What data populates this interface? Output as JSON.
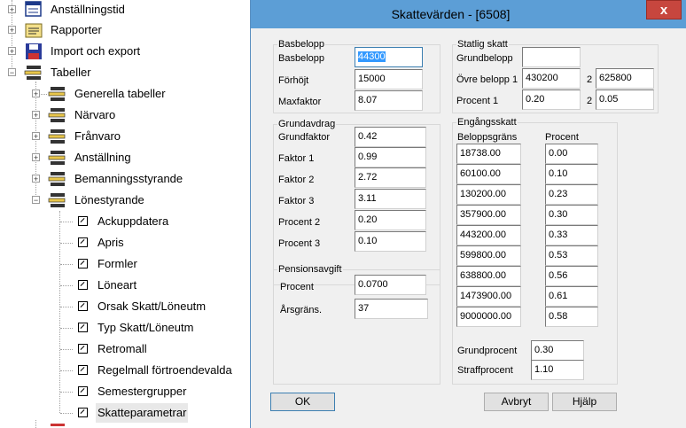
{
  "tree": {
    "items": [
      {
        "label": "Anställningstid",
        "icon": "calendar-icon"
      },
      {
        "label": "Rapporter",
        "icon": "report-icon"
      },
      {
        "label": "Import och export",
        "icon": "floppy-disk-icon"
      },
      {
        "label": "Tabeller",
        "icon": "table-stack-icon"
      },
      {
        "label": "Generella tabeller",
        "icon": "table-stack-icon"
      },
      {
        "label": "Närvaro",
        "icon": "table-stack-icon"
      },
      {
        "label": "Frånvaro",
        "icon": "table-stack-icon"
      },
      {
        "label": "Anställning",
        "icon": "table-stack-icon"
      },
      {
        "label": "Bemanningsstyrande",
        "icon": "table-stack-icon"
      },
      {
        "label": "Lönestyrande",
        "icon": "table-stack-icon"
      },
      {
        "label": "Ackuppdatera",
        "icon": "shortcut-icon"
      },
      {
        "label": "Apris",
        "icon": "shortcut-icon"
      },
      {
        "label": "Formler",
        "icon": "shortcut-icon"
      },
      {
        "label": "Löneart",
        "icon": "shortcut-icon"
      },
      {
        "label": "Orsak Skatt/Löneutm",
        "icon": "shortcut-icon"
      },
      {
        "label": "Typ Skatt/Löneutm",
        "icon": "shortcut-icon"
      },
      {
        "label": "Retromall",
        "icon": "shortcut-icon"
      },
      {
        "label": "Regelmall förtroendevalda",
        "icon": "shortcut-icon"
      },
      {
        "label": "Semestergrupper",
        "icon": "shortcut-icon"
      },
      {
        "label": "Skatteparametrar",
        "icon": "shortcut-icon"
      }
    ]
  },
  "dialog": {
    "title": "Skattevärden - [6508]",
    "close_label": "x",
    "basbelopp": {
      "group_label": "Basbelopp",
      "basbelopp_label": "Basbelopp",
      "basbelopp_value": "44300",
      "forhojt_label": "Förhöjt",
      "forhojt_value": "15000",
      "maxfaktor_label": "Maxfaktor",
      "maxfaktor_value": "8.07"
    },
    "grundavdrag": {
      "group_label": "Grundavdrag",
      "grundfaktor_label": "Grundfaktor",
      "grundfaktor_value": "0.42",
      "faktor1_label": "Faktor 1",
      "faktor1_value": "0.99",
      "faktor2_label": "Faktor 2",
      "faktor2_value": "2.72",
      "faktor3_label": "Faktor 3",
      "faktor3_value": "3.11",
      "procent2_label": "Procent 2",
      "procent2_value": "0.20",
      "procent3_label": "Procent 3",
      "procent3_value": "0.10"
    },
    "pensionsavgift": {
      "group_label": "Pensionsavgift",
      "procent_label": "Procent",
      "procent_value": "0.0700",
      "arsgrans_label": "Årsgräns.",
      "arsgrans_value": "37"
    },
    "statlig": {
      "group_label": "Statlig skatt",
      "grundbelopp_label": "Grundbelopp",
      "grundbelopp_value": "",
      "ovre_label": "Övre belopp 1",
      "ovre1_value": "430200",
      "ovre2_label": "2",
      "ovre2_value": "625800",
      "procent_label": "Procent  1",
      "procent1_value": "0.20",
      "procent2_label": "2",
      "procent2_value": "0.05"
    },
    "engangsskatt": {
      "group_label": "Engångsskatt",
      "col1_header": "Beloppsgräns",
      "col2_header": "Procent",
      "rows": [
        {
          "grans": "18738.00",
          "procent": "0.00"
        },
        {
          "grans": "60100.00",
          "procent": "0.10"
        },
        {
          "grans": "130200.00",
          "procent": "0.23"
        },
        {
          "grans": "357900.00",
          "procent": "0.30"
        },
        {
          "grans": "443200.00",
          "procent": "0.33"
        },
        {
          "grans": "599800.00",
          "procent": "0.53"
        },
        {
          "grans": "638800.00",
          "procent": "0.56"
        },
        {
          "grans": "1473900.00",
          "procent": "0.61"
        },
        {
          "grans": "9000000.00",
          "procent": "0.58"
        }
      ],
      "grundprocent_label": "Grundprocent",
      "grundprocent_value": "0.30",
      "straffprocent_label": "Straffprocent",
      "straffprocent_value": "1.10"
    },
    "buttons": {
      "ok": "OK",
      "avbryt": "Avbryt",
      "hjalp": "Hjälp"
    }
  }
}
